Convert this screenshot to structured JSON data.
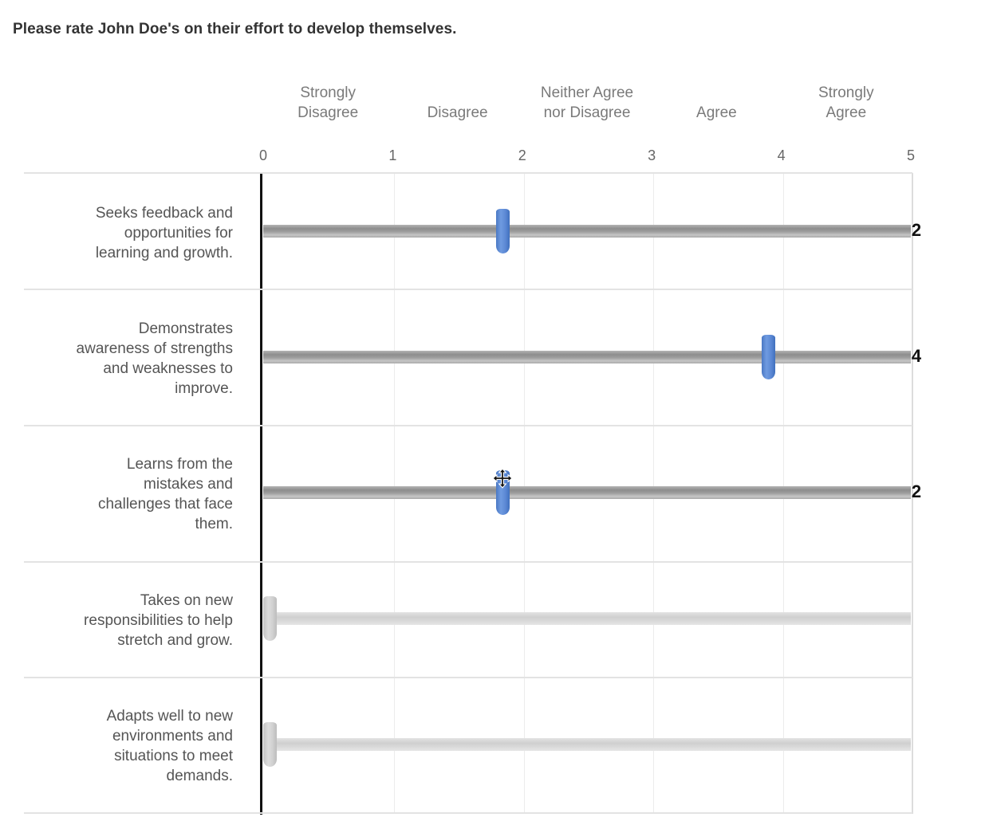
{
  "question": "Please rate John Doe's on their effort to develop themselves.",
  "scale": {
    "min": 0,
    "max": 5,
    "ticks": [
      "0",
      "1",
      "2",
      "3",
      "4",
      "5"
    ],
    "labels": [
      {
        "text": "Strongly Disagree",
        "line1": "Strongly",
        "line2": "Disagree",
        "position": 0.5
      },
      {
        "text": "Disagree",
        "line1": "",
        "line2": "Disagree",
        "position": 1.5
      },
      {
        "text": "Neither Agree nor Disagree",
        "line1": "Neither Agree",
        "line2": "nor Disagree",
        "position": 2.5
      },
      {
        "text": "Agree",
        "line1": "",
        "line2": "Agree",
        "position": 3.5
      },
      {
        "text": "Strongly Agree",
        "line1": "Strongly",
        "line2": "Agree",
        "position": 4.5
      }
    ]
  },
  "items": [
    {
      "statement": "Seeks feedback and opportunities for learning and growth.",
      "lines": [
        "Seeks feedback and",
        "opportunities for",
        "learning and growth."
      ],
      "value": 1.85,
      "display_value": "2",
      "answered": true
    },
    {
      "statement": "Demonstrates awareness of strengths and weaknesses to improve.",
      "lines": [
        "Demonstrates",
        "awareness of strengths",
        "and weaknesses to",
        "improve."
      ],
      "value": 3.9,
      "display_value": "4",
      "answered": true
    },
    {
      "statement": "Learns from the mistakes and challenges that face them.",
      "lines": [
        "Learns from the",
        "mistakes and",
        "challenges that face",
        "them."
      ],
      "value": 1.85,
      "display_value": "2",
      "answered": true
    },
    {
      "statement": "Takes on new responsibilities to help stretch and grow.",
      "lines": [
        "Takes on new",
        "responsibilities to help",
        "stretch and grow."
      ],
      "value": 0,
      "display_value": "",
      "answered": false
    },
    {
      "statement": "Adapts well to new environments and situations to meet demands.",
      "lines": [
        "Adapts well to new",
        "environments and",
        "situations to meet",
        "demands."
      ],
      "value": 0,
      "display_value": "",
      "answered": false
    }
  ],
  "colors": {
    "handle_active": "#5b88d4",
    "handle_inactive": "#d0d0d0",
    "track_active": "#9e9e9e",
    "track_inactive": "#dadada"
  },
  "cursor": {
    "icon": "move-cursor-icon",
    "over_item": 2
  }
}
